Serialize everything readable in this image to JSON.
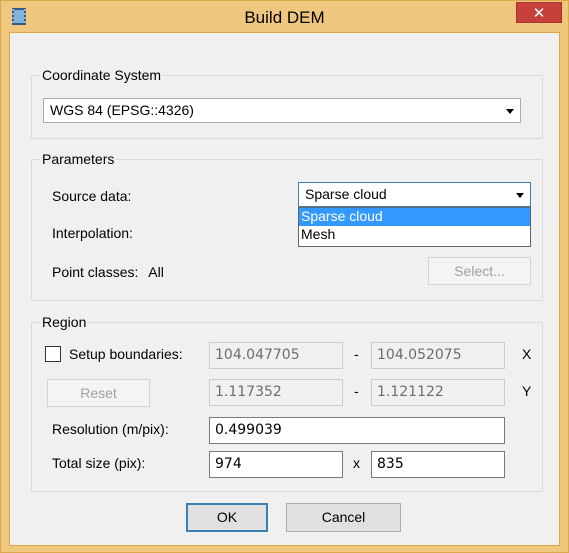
{
  "window": {
    "title": "Build DEM",
    "close_glyph": "✕"
  },
  "coordinate_system": {
    "group_title": "Coordinate System",
    "selected": "WGS 84 (EPSG::4326)"
  },
  "parameters": {
    "group_title": "Parameters",
    "source_label": "Source data:",
    "source_selected": "Sparse cloud",
    "source_options": [
      "Sparse cloud",
      "Mesh"
    ],
    "interpolation_label": "Interpolation:",
    "point_classes_label": "Point classes:",
    "point_classes_value": "All",
    "select_button": "Select..."
  },
  "region": {
    "group_title": "Region",
    "setup_boundaries_label": "Setup boundaries:",
    "setup_boundaries_checked": false,
    "x_min": "104.047705",
    "x_max": "104.052075",
    "x_axis": "X",
    "y_min": "1.117352",
    "y_max": "1.121122",
    "y_axis": "Y",
    "range_sep": "-",
    "reset_button": "Reset",
    "resolution_label": "Resolution (m/pix):",
    "resolution_value": "0.499039",
    "total_size_label": "Total size (pix):",
    "width": "974",
    "height": "835",
    "size_sep": "x"
  },
  "buttons": {
    "ok": "OK",
    "cancel": "Cancel"
  },
  "colors": {
    "title_bar": "#f0c77f",
    "close": "#c7413b",
    "selection": "#3399ff",
    "focus": "#3c7fb1"
  },
  "icons": {
    "app": "film-strip-icon",
    "close": "close-icon",
    "dropdown": "chevron-down-icon"
  }
}
